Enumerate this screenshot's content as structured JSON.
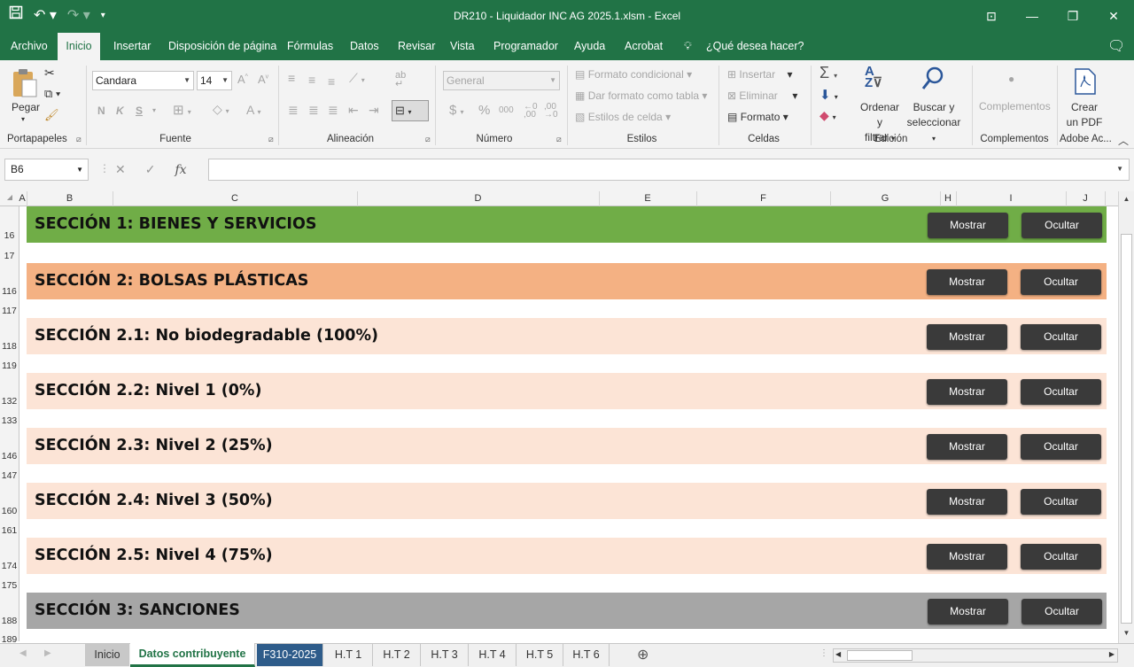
{
  "window": {
    "title": "DR210 - Liquidador INC AG 2025.1.xlsm  -  Excel"
  },
  "ribbon_tabs": [
    "Archivo",
    "Inicio",
    "Insertar",
    "Disposición de página",
    "Fórmulas",
    "Datos",
    "Revisar",
    "Vista",
    "Programador",
    "Ayuda",
    "Acrobat",
    "¿Qué desea hacer?"
  ],
  "ribbon": {
    "portapapeles": {
      "pegar": "Pegar",
      "label": "Portapapeles"
    },
    "fuente": {
      "font_name": "Candara",
      "font_size": "14",
      "bold": "N",
      "italic": "K",
      "underline": "S",
      "label": "Fuente"
    },
    "alineacion": {
      "label": "Alineación"
    },
    "numero": {
      "format": "General",
      "currency": "$",
      "percent": "%",
      "thousands": "000",
      "label": "Número"
    },
    "estilos": {
      "formato_condicional": "Formato condicional",
      "dar_formato": "Dar formato como tabla",
      "estilos_celda": "Estilos de celda",
      "label": "Estilos"
    },
    "celdas": {
      "insertar": "Insertar",
      "eliminar": "Eliminar",
      "formato": "Formato",
      "label": "Celdas"
    },
    "edicion": {
      "ordenar_1": "Ordenar y",
      "ordenar_2": "filtrar",
      "buscar_1": "Buscar y",
      "buscar_2": "seleccionar",
      "label": "Edición"
    },
    "complementos": {
      "button": "Complementos",
      "label": "Complementos"
    },
    "adobe": {
      "crear_1": "Crear",
      "crear_2": "un PDF",
      "label": "Adobe Ac..."
    }
  },
  "formula_bar": {
    "name_box": "B6",
    "fx": "fx",
    "formula": ""
  },
  "columns": [
    "A",
    "B",
    "C",
    "D",
    "E",
    "F",
    "G",
    "H",
    "I",
    "J"
  ],
  "rows": [
    "16",
    "17",
    "116",
    "117",
    "118",
    "119",
    "132",
    "133",
    "146",
    "147",
    "160",
    "161",
    "174",
    "175",
    "188",
    "189"
  ],
  "sections": [
    {
      "title": "SECCIÓN 1: BIENES Y SERVICIOS",
      "color": "#70ad47",
      "show": "Mostrar",
      "hide": "Ocultar"
    },
    {
      "title": "SECCIÓN 2: BOLSAS PLÁSTICAS",
      "color": "#f4b183",
      "show": "Mostrar",
      "hide": "Ocultar"
    },
    {
      "title": "SECCIÓN 2.1: No biodegradable (100%)",
      "color": "#fce4d6",
      "show": "Mostrar",
      "hide": "Ocultar"
    },
    {
      "title": "SECCIÓN 2.2: Nivel 1 (0%)",
      "color": "#fce4d6",
      "show": "Mostrar",
      "hide": "Ocultar"
    },
    {
      "title": "SECCIÓN 2.3: Nivel 2 (25%)",
      "color": "#fce4d6",
      "show": "Mostrar",
      "hide": "Ocultar"
    },
    {
      "title": "SECCIÓN 2.4: Nivel 3 (50%)",
      "color": "#fce4d6",
      "show": "Mostrar",
      "hide": "Ocultar"
    },
    {
      "title": "SECCIÓN 2.5: Nivel 4 (75%)",
      "color": "#fce4d6",
      "show": "Mostrar",
      "hide": "Ocultar"
    },
    {
      "title": "SECCIÓN 3: SANCIONES",
      "color": "#a6a6a6",
      "show": "Mostrar",
      "hide": "Ocultar"
    }
  ],
  "sheet_tabs": [
    "Inicio",
    "Datos contribuyente",
    "F310-2025",
    "H.T 1",
    "H.T 2",
    "H.T 3",
    "H.T 4",
    "H.T 5",
    "H.T 6"
  ],
  "colors": {
    "excel_green": "#217346",
    "button_dark": "#3a3a3a",
    "active_sheet_blue": "#2e5c8a"
  }
}
